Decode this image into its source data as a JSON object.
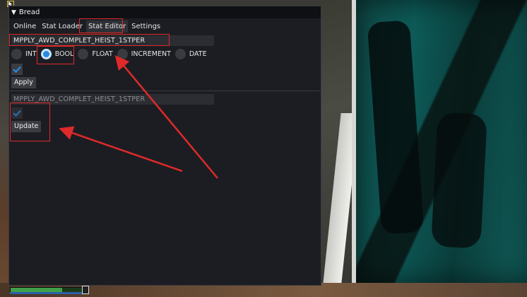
{
  "window": {
    "title": "Bread",
    "collapse_glyph": "▼",
    "tabs": [
      {
        "label": "Online"
      },
      {
        "label": "Stat Loader"
      },
      {
        "label": "Stat Editor"
      },
      {
        "label": "Settings"
      }
    ],
    "active_tab": "Stat Editor"
  },
  "editor": {
    "stat_name_value": "MPPLY_AWD_COMPLET_HEIST_1STPER",
    "type_options": [
      "INT",
      "BOOL",
      "FLOAT",
      "INCREMENT",
      "DATE"
    ],
    "selected_type": "BOOL",
    "checkbox_checked": true,
    "apply_label": "Apply"
  },
  "result": {
    "stat_name_placeholder": "MPPLY_AWD_COMPLET_HEIST_1STPER",
    "checkbox_checked": true,
    "update_label": "Update"
  },
  "colors": {
    "accent": "#2a88e0",
    "highlight": "#e02a2a"
  },
  "icons": {
    "check": "checkmark-icon",
    "collapse": "triangle-down-icon"
  }
}
